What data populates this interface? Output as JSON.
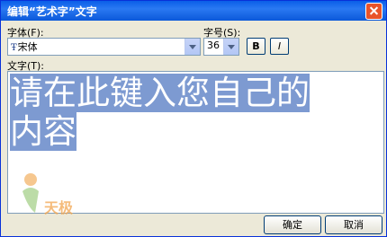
{
  "window": {
    "title": "编辑“艺术字”文字"
  },
  "font": {
    "label": "字体(F):",
    "value": "宋体"
  },
  "size": {
    "label": "字号(S):",
    "value": "36"
  },
  "format": {
    "bold": "B",
    "italic": "I"
  },
  "text": {
    "label": "文字(T):",
    "line1": "请在此键入您自己的",
    "line2": "内容"
  },
  "buttons": {
    "ok": "确定",
    "cancel": "取消"
  },
  "watermark": {
    "text": "天极"
  }
}
